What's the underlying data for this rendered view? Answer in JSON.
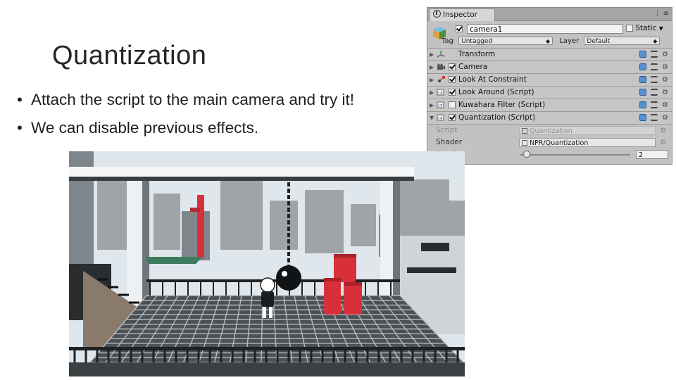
{
  "slide": {
    "title": "Quantization",
    "bullets": [
      "Attach the script to the main camera and try it!",
      "We can disable previous effects."
    ],
    "bullet_char": "•"
  },
  "inspector": {
    "tab_label": "Inspector",
    "tab_controls": "⋮ ≡",
    "object": {
      "name": "camera1",
      "static_label": "Static",
      "tag_label": "Tag",
      "tag_value": "Untagged",
      "layer_label": "Layer",
      "layer_value": "Default"
    },
    "components": [
      {
        "label": "Transform",
        "enabled": null,
        "icon": "transform-icon"
      },
      {
        "label": "Camera",
        "enabled": true,
        "icon": "camera-icon"
      },
      {
        "label": "Look At Constraint",
        "enabled": true,
        "icon": "constraint-icon"
      },
      {
        "label": "Look Around (Script)",
        "enabled": true,
        "icon": "script-icon"
      },
      {
        "label": "Kuwahara Filter (Script)",
        "enabled": false,
        "icon": "script-icon"
      },
      {
        "label": "Quantization (Script)",
        "enabled": true,
        "icon": "script-icon",
        "expanded": true
      }
    ],
    "properties": {
      "script_label": "Script",
      "script_value": "Quantization",
      "shader_label": "Shader",
      "shader_value": "NPR/Quantization",
      "levels_label": "Levels",
      "levels_value": "2"
    }
  },
  "game_view": {
    "description_free": true,
    "colors": {
      "sky": "#dfe7ec",
      "red": "#d8303a",
      "green": "#3f7b5e"
    }
  }
}
